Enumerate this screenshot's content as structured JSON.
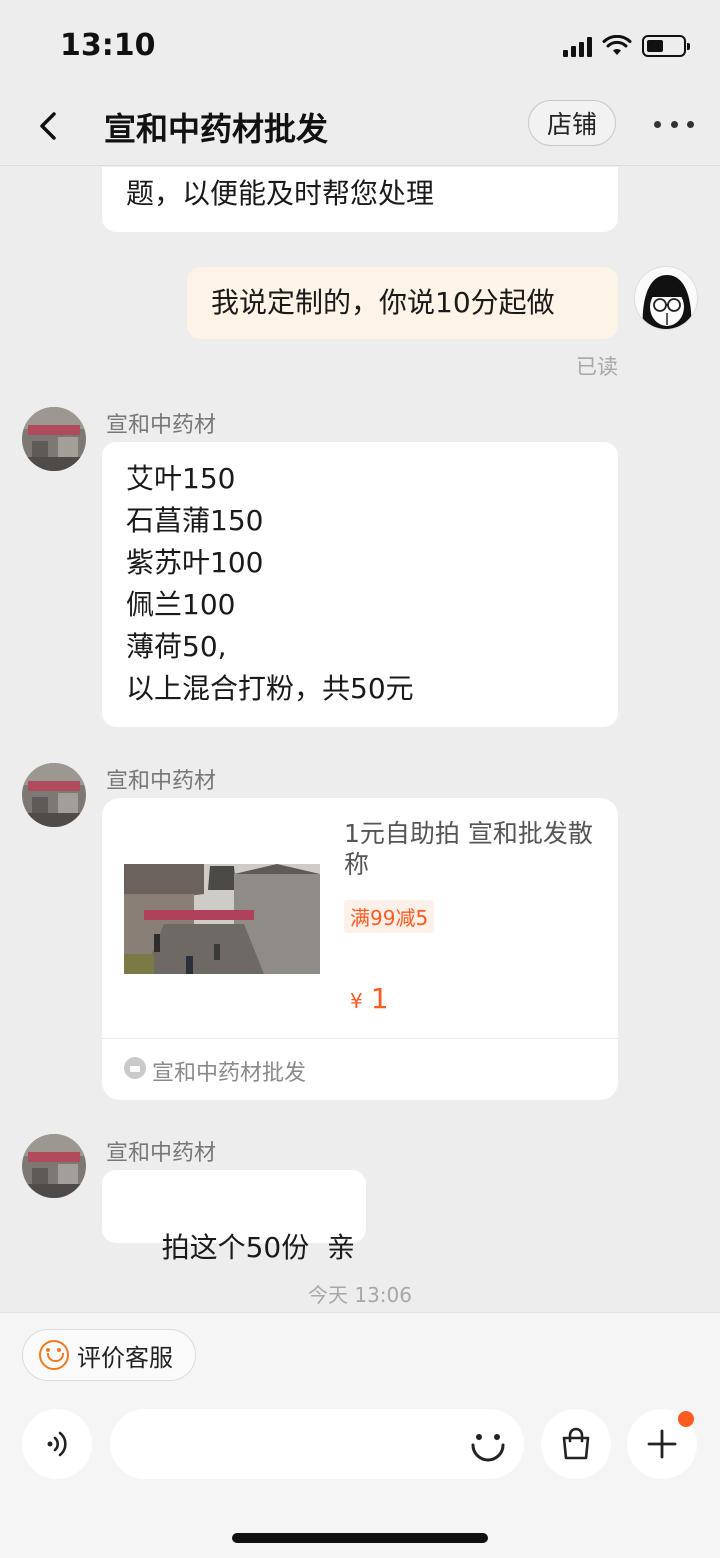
{
  "status_bar": {
    "time": "13:10"
  },
  "nav": {
    "title": "宣和中药材批发",
    "shop_button": "店铺"
  },
  "messages": {
    "partial_bubble": "题，以便能及时帮您处理",
    "my_message": "我说定制的，你说10分起做",
    "read_status": "已读",
    "sender_name": "宣和中药材",
    "list_lines": [
      "艾叶150",
      "石菖蒲150",
      "紫苏叶100",
      "佩兰100",
      "薄荷50,",
      "以上混合打粉，共50元"
    ],
    "reply": "拍这个50份  亲",
    "timestamp": "今天 13:06"
  },
  "product_card": {
    "title": "1元自助拍 宣和批发散称",
    "promo_tag": "满99减5",
    "currency": "¥",
    "price": "1",
    "shop_name": "宣和中药材批发"
  },
  "bottom_bar": {
    "rate_button": "评价客服"
  },
  "colors": {
    "accent": "#ff5a1f",
    "my_bubble": "#fdf3e6",
    "background": "#ededed"
  }
}
